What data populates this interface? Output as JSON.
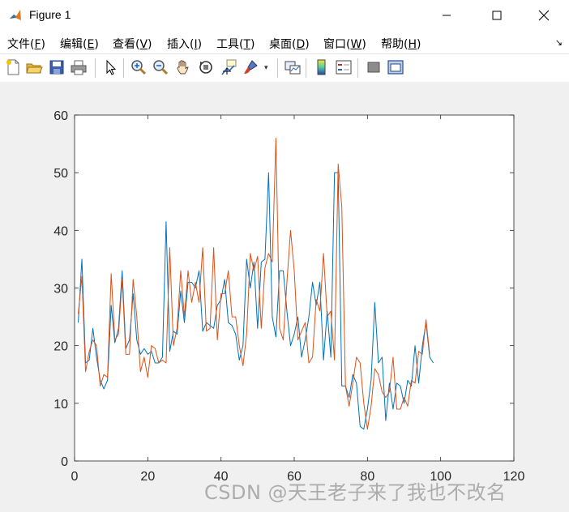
{
  "window": {
    "title": "Figure 1"
  },
  "menubar": {
    "items": [
      {
        "label": "文件",
        "accel": "F",
        "name": "menu-file"
      },
      {
        "label": "编辑",
        "accel": "E",
        "name": "menu-edit"
      },
      {
        "label": "查看",
        "accel": "V",
        "name": "menu-view"
      },
      {
        "label": "插入",
        "accel": "I",
        "name": "menu-insert"
      },
      {
        "label": "工具",
        "accel": "T",
        "name": "menu-tools"
      },
      {
        "label": "桌面",
        "accel": "D",
        "name": "menu-desktop"
      },
      {
        "label": "窗口",
        "accel": "W",
        "name": "menu-window"
      },
      {
        "label": "帮助",
        "accel": "H",
        "name": "menu-help"
      }
    ]
  },
  "toolbar": {
    "icons": [
      "new-figure-icon",
      "open-file-icon",
      "save-icon",
      "print-icon",
      "select-arrow-icon",
      "zoom-in-icon",
      "zoom-out-icon",
      "pan-hand-icon",
      "rotate-3d-icon",
      "data-cursor-icon",
      "brush-icon",
      "brush-dropdown-icon",
      "link-plot-icon",
      "colorbar-icon",
      "legend-icon",
      "hide-plot-tools-icon",
      "show-plot-tools-icon"
    ]
  },
  "watermark": "CSDN @天王老子来了我也不改名",
  "chart_data": {
    "type": "line",
    "title": "",
    "xlabel": "",
    "ylabel": "",
    "xlim": [
      0,
      120
    ],
    "ylim": [
      0,
      60
    ],
    "xticks": [
      0,
      20,
      40,
      60,
      80,
      100,
      120
    ],
    "yticks": [
      0,
      10,
      20,
      30,
      40,
      50,
      60
    ],
    "grid": false,
    "x_start": 1,
    "series": [
      {
        "color": "#0072BD",
        "values": [
          24,
          35,
          17,
          17.5,
          23,
          18,
          14,
          12.5,
          14,
          27,
          20.5,
          23,
          33,
          19.5,
          21,
          29,
          21,
          18.5,
          19.5,
          18.5,
          19,
          17,
          17,
          18,
          41.5,
          19,
          22.5,
          22,
          29.5,
          24,
          31,
          31,
          30,
          33,
          22.5,
          24,
          23.5,
          23,
          27,
          28,
          31.5,
          24,
          23.5,
          22,
          17.5,
          20,
          35,
          30,
          34.5,
          23,
          34.5,
          35,
          50,
          25,
          21.5,
          33,
          33,
          26,
          20,
          22,
          25,
          18,
          21,
          25,
          31,
          27,
          31,
          17.5,
          26,
          18,
          50,
          50,
          13,
          13,
          11,
          15,
          13.5,
          6,
          5.5,
          9,
          14,
          27.5,
          17,
          18,
          7,
          13.5,
          9,
          13.5,
          13,
          10,
          14,
          13,
          20,
          13.5,
          20,
          24,
          18,
          17
        ]
      },
      {
        "color": "#D95319",
        "values": [
          25.5,
          32,
          15.5,
          19,
          21,
          20,
          13,
          15,
          14.5,
          32.5,
          21,
          22,
          31.5,
          18.5,
          18.5,
          31.5,
          25,
          15.5,
          18,
          14.5,
          20,
          19.5,
          17,
          17.5,
          17,
          37,
          20,
          23,
          33,
          25,
          33,
          27.5,
          31,
          27.5,
          37,
          22.5,
          23,
          37,
          21,
          29,
          29,
          33,
          25,
          25,
          20,
          16.5,
          22,
          36,
          33,
          35.5,
          23,
          33.5,
          36,
          34.5,
          56,
          23,
          21,
          31,
          40,
          33,
          21,
          22.5,
          24,
          17,
          18,
          28,
          26,
          36,
          25,
          26,
          17.5,
          51.5,
          44,
          13,
          9.5,
          13.5,
          18,
          17,
          10,
          5.5,
          9.5,
          16,
          15,
          12,
          11,
          12,
          18,
          9,
          9,
          11,
          9.5,
          14,
          13.5,
          19,
          18.5,
          24.5,
          18.5
        ]
      }
    ]
  }
}
